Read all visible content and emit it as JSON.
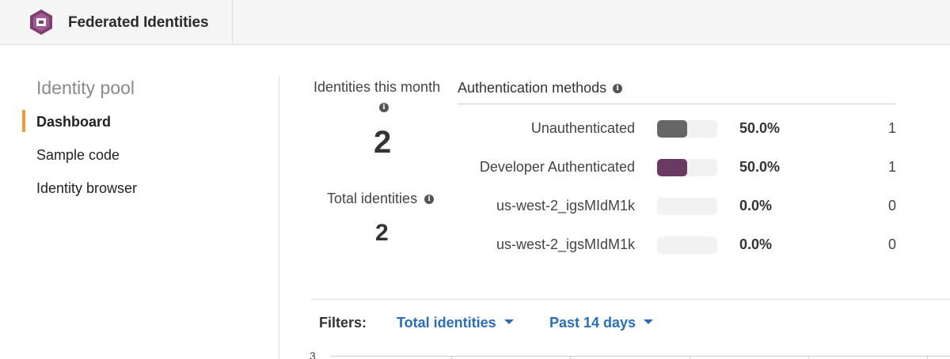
{
  "header": {
    "title": "Federated Identities",
    "logo_icon": "cognito-logo-icon",
    "brand_color": "#7d3f6e"
  },
  "sidebar": {
    "heading": "Identity pool",
    "items": [
      {
        "label": "Dashboard",
        "active": true
      },
      {
        "label": "Sample code",
        "active": false
      },
      {
        "label": "Identity browser",
        "active": false
      }
    ],
    "active_color": "#f39a37"
  },
  "stats": {
    "identities_this_month_label": "Identities this month",
    "identities_this_month_value": "2",
    "total_identities_label": "Total identities",
    "total_identities_value": "2"
  },
  "auth_methods": {
    "title": "Authentication methods",
    "rows": [
      {
        "name": "Unauthenticated",
        "fraction": 0.5,
        "percent": "50.0%",
        "count": "1",
        "color": "#666666"
      },
      {
        "name": "Developer Authenticated",
        "fraction": 0.5,
        "percent": "50.0%",
        "count": "1",
        "color": "#6b3a62"
      },
      {
        "name": "us-west-2_igsMIdM1k",
        "fraction": 0.0,
        "percent": "0.0%",
        "count": "0",
        "color": "#666666"
      },
      {
        "name": "us-west-2_igsMIdM1k",
        "fraction": 0.0,
        "percent": "0.0%",
        "count": "0",
        "color": "#666666"
      }
    ]
  },
  "filters": {
    "label": "Filters:",
    "metric": "Total identities",
    "range": "Past 14 days",
    "link_color": "#2a6ebb"
  },
  "chart": {
    "y_top_label": "3"
  }
}
